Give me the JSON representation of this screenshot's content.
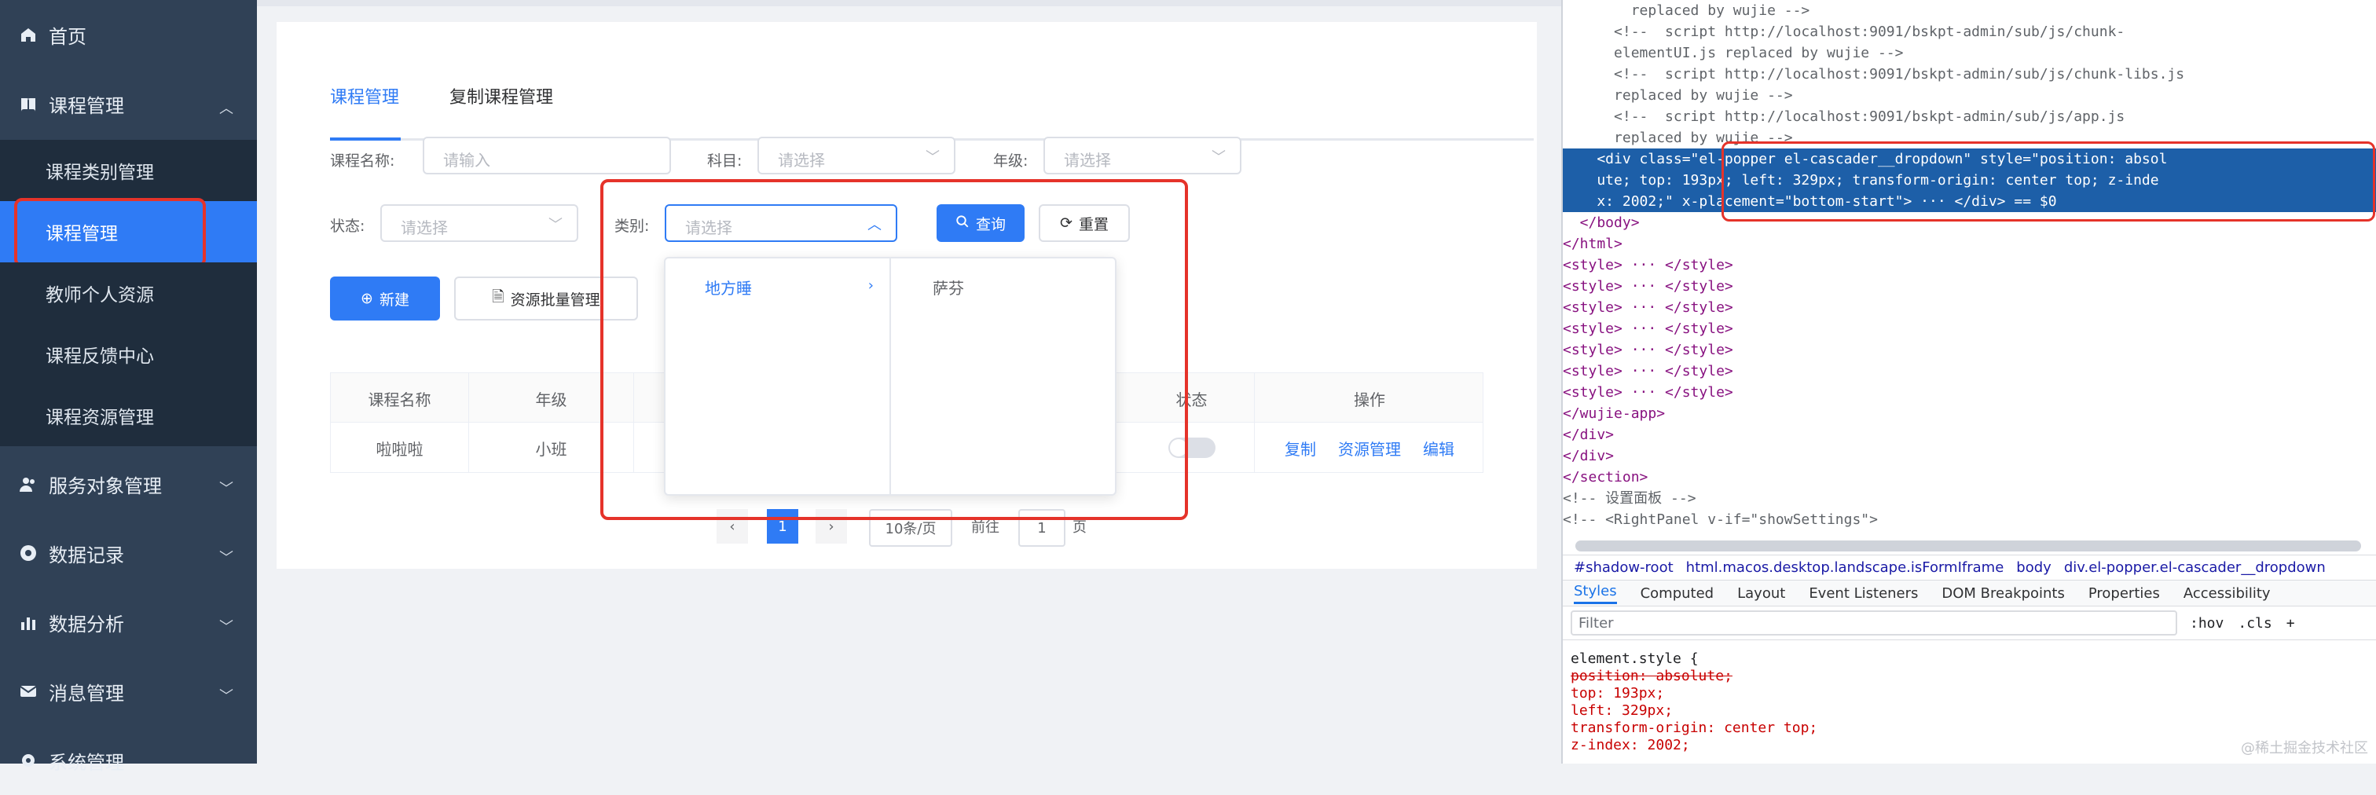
{
  "sidebar": {
    "top_items": [
      {
        "label": "首页",
        "icon": "home-icon"
      },
      {
        "label": "课程管理",
        "icon": "book-icon"
      },
      {
        "label": "服务对象管理",
        "icon": "users-icon"
      },
      {
        "label": "数据记录",
        "icon": "record-icon"
      },
      {
        "label": "数据分析",
        "icon": "chart-icon"
      },
      {
        "label": "消息管理",
        "icon": "mail-icon"
      },
      {
        "label": "系统管理",
        "icon": "gear-icon"
      }
    ],
    "sub_items": [
      "课程类别管理",
      "课程管理",
      "教师个人资源",
      "课程反馈中心",
      "课程资源管理"
    ]
  },
  "tabs": [
    "课程管理",
    "复制课程管理"
  ],
  "filters": {
    "course_name_label": "课程名称:",
    "course_name_placeholder": "请输入",
    "subject_label": "科目:",
    "subject_placeholder": "请选择",
    "grade_label": "年级:",
    "grade_placeholder": "请选择",
    "status_label": "状态:",
    "status_placeholder": "请选择",
    "category_label": "类别:",
    "category_placeholder": "请选择"
  },
  "buttons": {
    "query": "查询",
    "reset": "重置",
    "new": "新建",
    "bulk": "资源批量管理"
  },
  "table": {
    "headers": [
      "课程名称",
      "年级",
      "状态",
      "操作"
    ],
    "row": {
      "name": "啦啦啦",
      "grade": "小班",
      "ops": [
        "复制",
        "资源管理",
        "编辑"
      ]
    }
  },
  "dropdown": {
    "level1": "地方睡",
    "level2": "萨芬"
  },
  "pager": {
    "page": "1",
    "size": "10条/页",
    "goto": "前往",
    "goto_page": "1",
    "unit": "页"
  },
  "devtools": {
    "code_lines": [
      "        replaced by wujie -->",
      "      <!--  script http://localhost:9091/bskpt-admin/sub/js/chunk-",
      "      elementUI.js replaced by wujie -->",
      "      <!--  script http://localhost:9091/bskpt-admin/sub/js/chunk-libs.js",
      "      replaced by wujie -->",
      "      <!--  script http://localhost:9091/bskpt-admin/sub/js/app.js",
      "      replaced by wujie -->",
      "    <div class=\"el-popper el-cascader__dropdown\" style=\"position: absol",
      "    ute; top: 193px; left: 329px; transform-origin: center top; z-inde",
      "    x: 2002;\" x-placement=\"bottom-start\"> ··· </div> == $0",
      "  </body>",
      "</html>",
      "<style> ··· </style>",
      "<style> ··· </style>",
      "<style> ··· </style>",
      "<style> ··· </style>",
      "<style> ··· </style>",
      "<style> ··· </style>",
      "<style> ··· </style>",
      "</wujie-app>",
      "</div>",
      "</div>",
      "</section>",
      "<!-- 设置面板 -->",
      "<!-- <RightPanel v-if=\"showSettings\">"
    ],
    "breadcrumbs": [
      "#shadow-root",
      "html.macos.desktop.landscape.isFormIframe",
      "body",
      "div.el-popper.el-cascader__dropdown"
    ],
    "tabs": [
      "Styles",
      "Computed",
      "Layout",
      "Event Listeners",
      "DOM Breakpoints",
      "Properties",
      "Accessibility"
    ],
    "filter_placeholder": "Filter",
    "filter_tools": [
      ":hov",
      ".cls",
      "+"
    ],
    "style_lines": [
      "element.style {",
      "  position: absolute;",
      "  top: 193px;",
      "  left: 329px;",
      "  transform-origin: center top;",
      "  z-index: 2002;"
    ],
    "watermark": "@稀土掘金技术社区"
  }
}
